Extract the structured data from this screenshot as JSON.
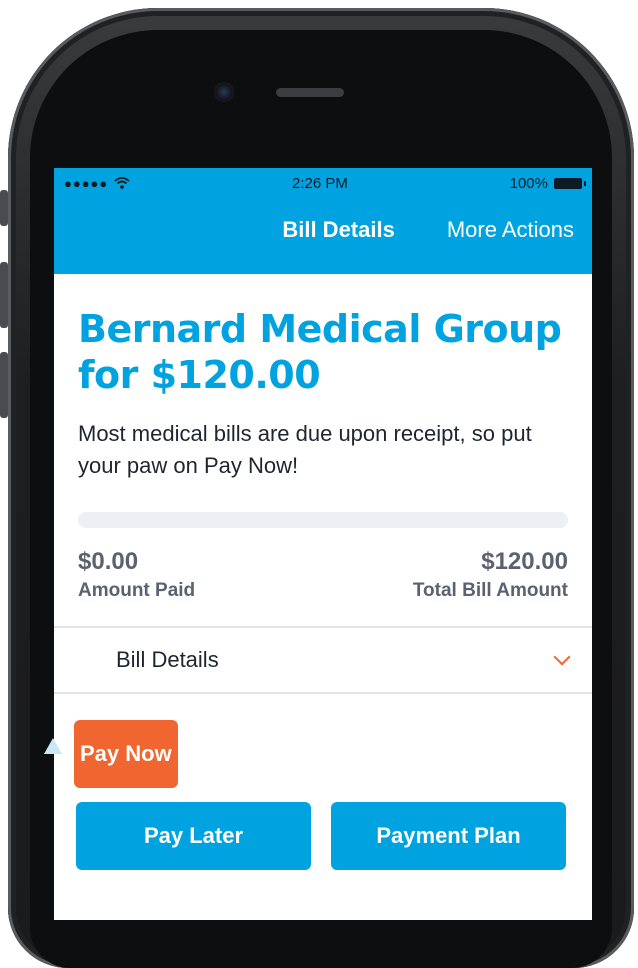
{
  "status_bar": {
    "signal": "●●●●●",
    "wifi_icon": "wifi-icon",
    "time": "2:26 PM",
    "battery": "100%"
  },
  "nav": {
    "tabs": [
      {
        "label": "Bill Details",
        "active": true
      },
      {
        "label": "More Actions",
        "active": false
      }
    ]
  },
  "bill": {
    "title_line1": "Bernard Medical Group",
    "title_line2": "for $120.00",
    "description": "Most medical bills are due upon receipt, so put your paw on Pay Now!",
    "progress_fraction": 0,
    "amount_paid_value": "$0.00",
    "amount_paid_label": "Amount Paid",
    "total_value": "$120.00",
    "total_label": "Total Bill Amount"
  },
  "details_row": {
    "label": "Bill Details",
    "icon": "chevron-down-icon"
  },
  "actions": {
    "pay_now": "Pay Now",
    "pay_later": "Pay Later",
    "payment_plan": "Payment Plan"
  },
  "colors": {
    "brand_blue": "#00a3df",
    "accent_orange": "#f06530",
    "muted_text": "#5a6170"
  }
}
